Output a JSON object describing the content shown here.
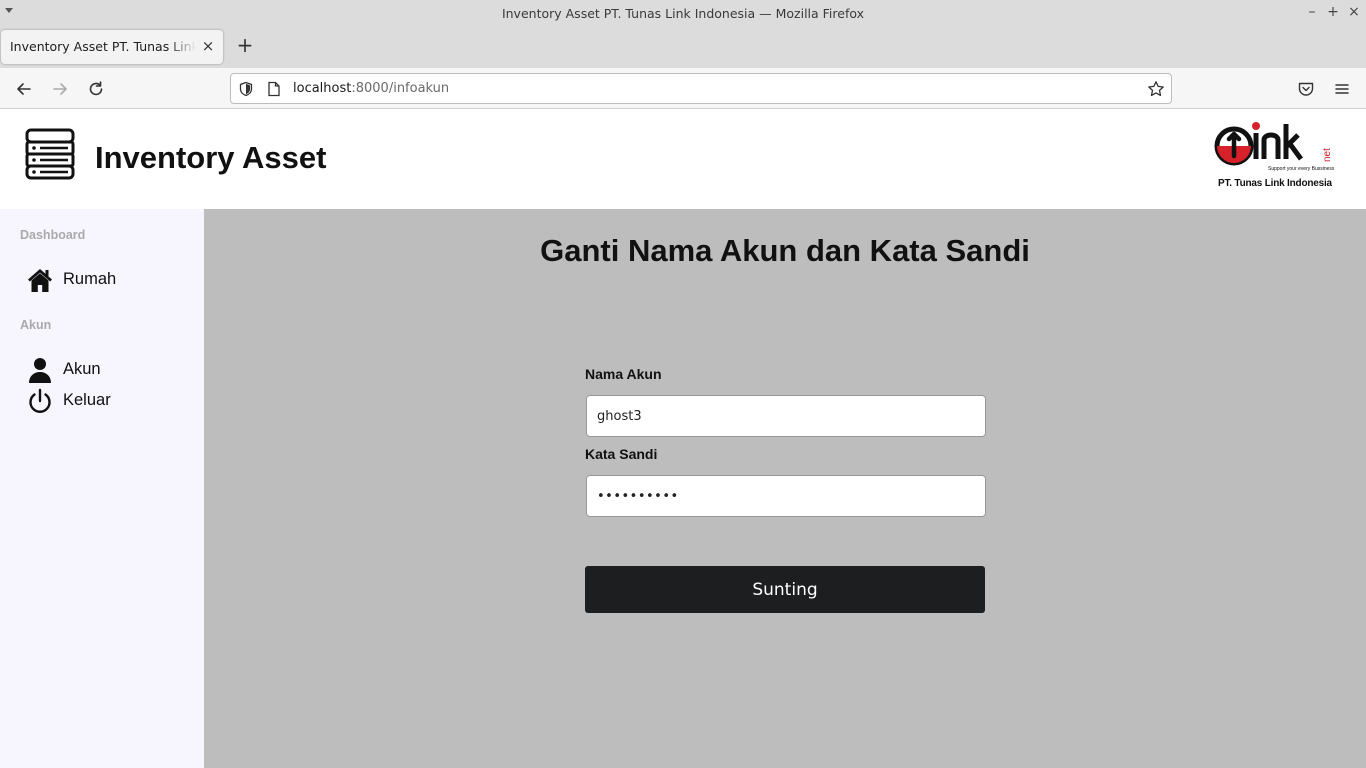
{
  "browser": {
    "window_title": "Inventory Asset PT. Tunas Link Indonesia — Mozilla Firefox",
    "tab_title": "Inventory Asset PT. Tunas Link Indonesia",
    "url_host": "localhost",
    "url_path": ":8000/infoakun"
  },
  "header": {
    "title": "Inventory Asset",
    "logo_caption": "PT. Tunas Link Indonesia",
    "logo_text": "Link net",
    "logo_tagline": "Support your every Bussiness"
  },
  "sidebar": {
    "sections": [
      {
        "label": "Dashboard"
      },
      {
        "label": "Akun"
      }
    ],
    "items": [
      {
        "label": "Rumah",
        "icon": "home-icon"
      },
      {
        "label": "Akun",
        "icon": "user-icon"
      },
      {
        "label": "Keluar",
        "icon": "power-icon"
      }
    ]
  },
  "main": {
    "heading": "Ganti Nama Akun dan Kata Sandi",
    "username_label": "Nama Akun",
    "username_value": "ghost3",
    "password_label": "Kata Sandi",
    "password_value": "••••••••••",
    "submit_label": "Sunting"
  },
  "colors": {
    "sidebar_bg": "#f7f6fe",
    "main_bg": "#bdbdbd",
    "button_bg": "#1d1e20",
    "logo_red": "#d6202a"
  }
}
